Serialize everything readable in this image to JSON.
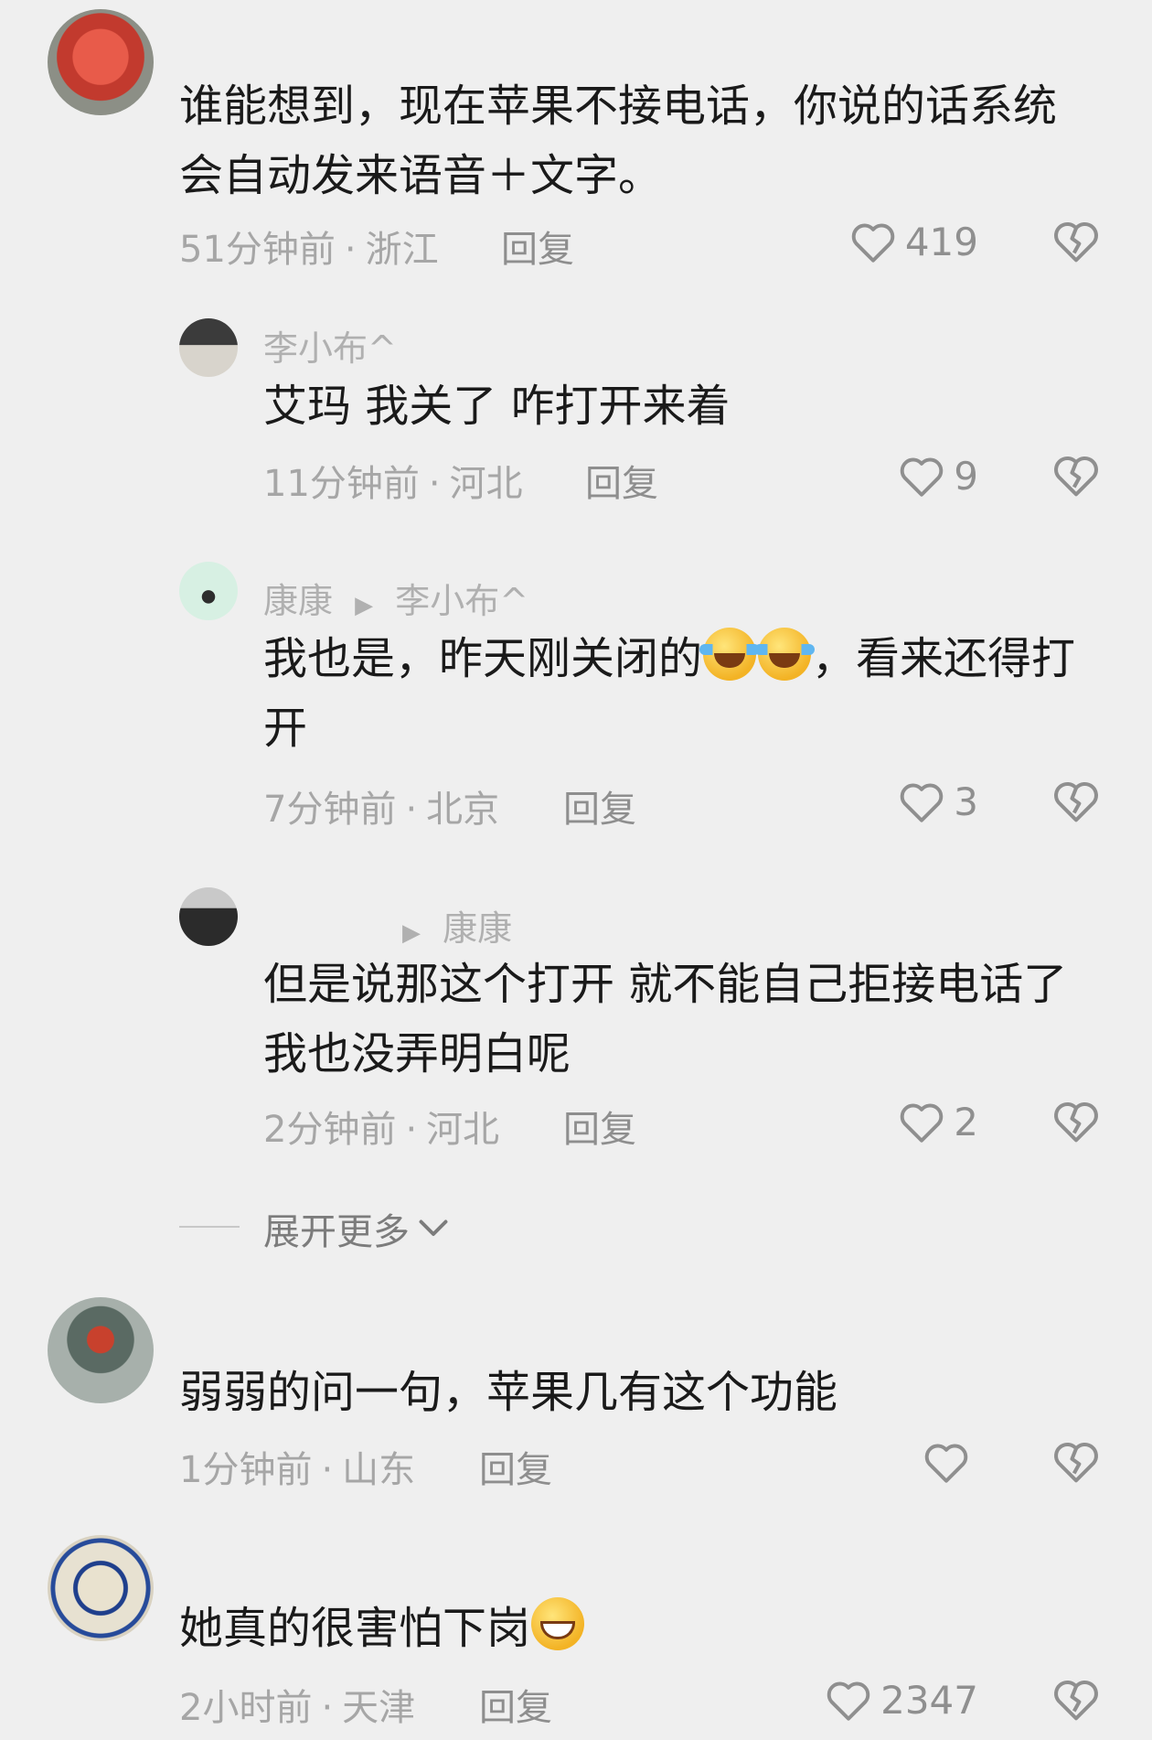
{
  "comments": [
    {
      "text": "谁能想到，现在苹果不接电话，你说的话系统会自动发来语音＋文字。",
      "time": "51分钟前",
      "location": "浙江",
      "reply": "回复",
      "likes": "419"
    },
    {
      "username": "李小布^",
      "text": "艾玛 我关了 咋打开来着",
      "time": "11分钟前",
      "location": "河北",
      "reply": "回复",
      "likes": "9"
    },
    {
      "username": "康康",
      "reply_to": "李小布^",
      "text_before": "我也是，昨天刚关闭的",
      "text_after": "，看来还得打开",
      "time": "7分钟前",
      "location": "北京",
      "reply": "回复",
      "likes": "3"
    },
    {
      "reply_to": "康康",
      "text": "但是说那这个打开 就不能自己拒接电话了 我也没弄明白呢",
      "time": "2分钟前",
      "location": "河北",
      "reply": "回复",
      "likes": "2"
    },
    {
      "text": "弱弱的问一句，苹果几有这个功能",
      "time": "1分钟前",
      "location": "山东",
      "reply": "回复",
      "likes": ""
    },
    {
      "text": "她真的很害怕下岗",
      "time": "2小时前",
      "location": "天津",
      "reply": "回复",
      "likes": "2347"
    }
  ],
  "expand_label": "展开更多",
  "icons": {
    "like": "heart-outline-icon",
    "dislike": "broken-heart-icon",
    "expand": "chevron-down-icon",
    "emoji_laugh": "tears-of-joy-emoji",
    "emoji_grin": "grinning-emoji"
  },
  "colors": {
    "background": "#efefef",
    "text": "#1a1a1a",
    "meta": "#a6a6a6"
  }
}
